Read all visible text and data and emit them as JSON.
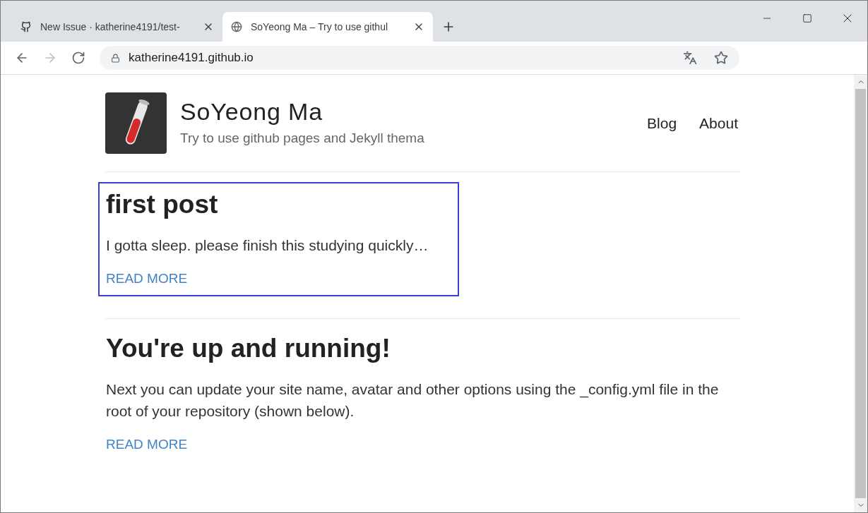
{
  "browser": {
    "tabs": [
      {
        "title": "New Issue · katherine4191/test-",
        "kind": "github",
        "selected": false
      },
      {
        "title": "SoYeong Ma – Try to use githul",
        "kind": "globe",
        "selected": true
      }
    ],
    "address": "katherine4191.github.io"
  },
  "site": {
    "title": "SoYeong Ma",
    "tagline": "Try to use github pages and Jekyll thema",
    "nav": [
      "Blog",
      "About"
    ]
  },
  "posts": [
    {
      "title": "first post",
      "excerpt": "I gotta sleep. please finish this studying quickly…",
      "link": "READ MORE",
      "selected": true
    },
    {
      "title": "You're up and running!",
      "excerpt": "Next you can update your site name, avatar and other options using the _config.yml file in the root of your repository (shown below).",
      "link": "READ MORE",
      "selected": false
    }
  ]
}
